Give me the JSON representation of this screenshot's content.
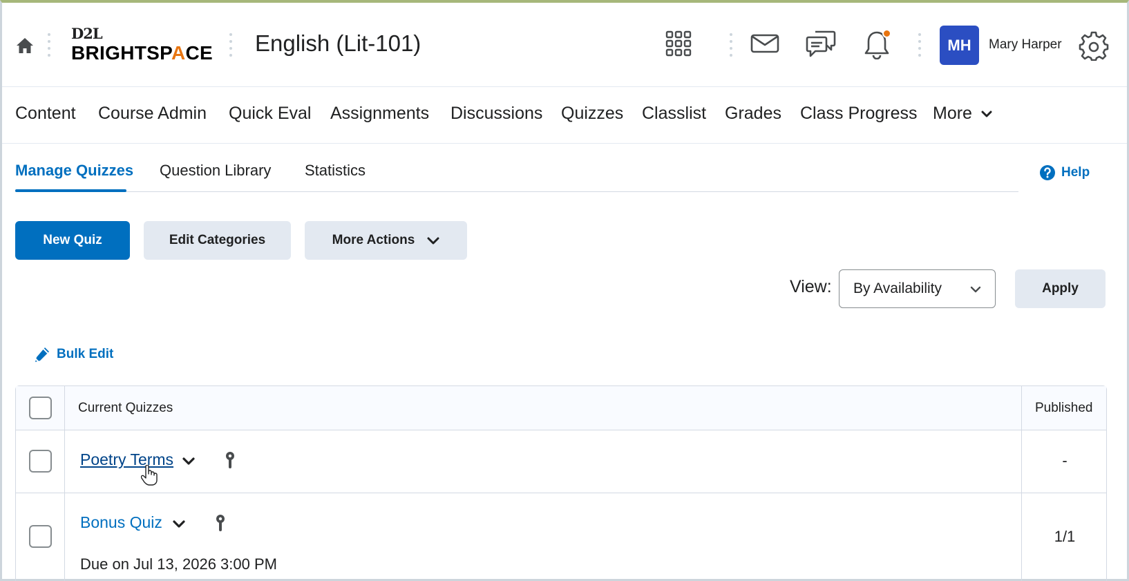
{
  "header": {
    "logo_top": "D2L",
    "logo_main_1": "BRIGHTSP",
    "logo_main_a": "A",
    "logo_main_2": "CE",
    "course_title": "English (Lit-101)",
    "user_initials": "MH",
    "user_name": "Mary Harper",
    "icons": [
      "home-icon",
      "waffle-icon",
      "mail-icon",
      "chat-icon",
      "bell-icon",
      "gear-icon"
    ],
    "accent_color": "#e87511",
    "avatar_color": "#2b4ec2"
  },
  "nav": {
    "items": [
      "Content",
      "Course Admin",
      "Quick Eval",
      "Assignments",
      "Discussions",
      "Quizzes",
      "Classlist",
      "Grades",
      "Class Progress",
      "More"
    ]
  },
  "tabs": {
    "items": [
      "Manage Quizzes",
      "Question Library",
      "Statistics"
    ],
    "active": "Manage Quizzes",
    "help_label": "Help"
  },
  "actions": {
    "new_quiz": "New Quiz",
    "edit_categories": "Edit Categories",
    "more_actions": "More Actions",
    "primary_color": "#006fbf"
  },
  "view": {
    "label": "View:",
    "selected": "By Availability",
    "apply": "Apply"
  },
  "bulk_edit": "Bulk Edit",
  "table": {
    "headers": [
      "Current Quizzes",
      "Published"
    ],
    "rows": [
      {
        "name": "Poetry Terms",
        "due": "",
        "published": "-"
      },
      {
        "name": "Bonus Quiz",
        "due": "Due on Jul 13, 2026 3:00 PM",
        "published": "1/1"
      }
    ]
  }
}
